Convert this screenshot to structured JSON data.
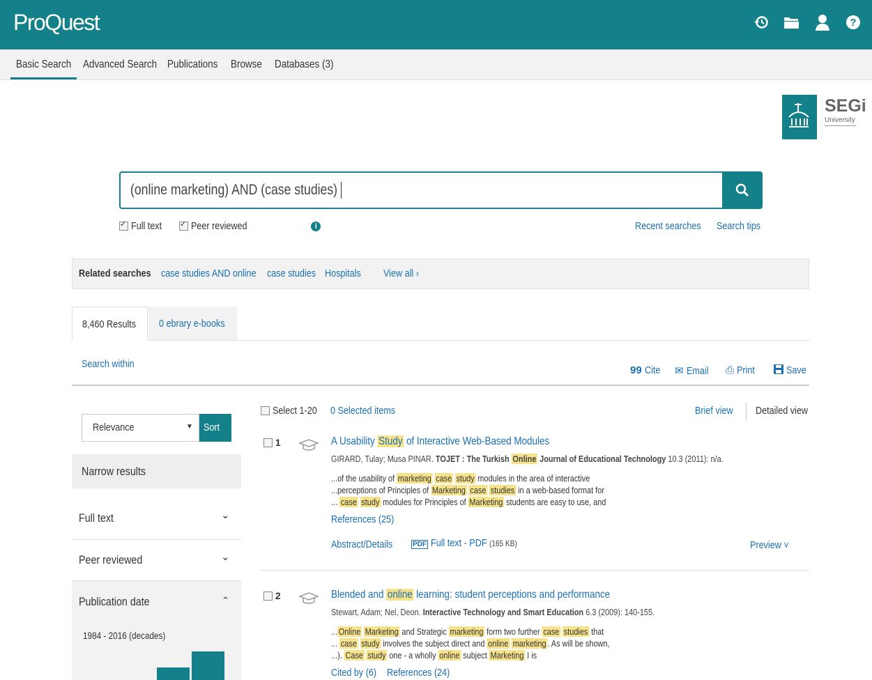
{
  "header": {
    "logo": "ProQuest",
    "icons": [
      "history-icon",
      "folder-icon",
      "user-icon",
      "help-icon"
    ]
  },
  "nav": {
    "tabs": [
      "Basic Search",
      "Advanced Search",
      "Publications",
      "Browse",
      "Databases (3)"
    ],
    "active": "Basic Search"
  },
  "institution": {
    "name": "SEGi",
    "sub": "University"
  },
  "search": {
    "query": "(online marketing) AND (case studies)"
  },
  "options": {
    "full_text": "Full text",
    "peer_reviewed": "Peer reviewed",
    "recent": "Recent searches",
    "tips": "Search tips"
  },
  "related": {
    "label": "Related searches",
    "items": [
      "case studies AND online",
      "case studies",
      "Hospitals"
    ],
    "view_all": "View all ›"
  },
  "results_tabs": {
    "results": "8,460 Results",
    "ebooks": "0 ebrary e-books"
  },
  "toolbar": {
    "search_within": "Search within",
    "cite": "Cite",
    "email": "Email",
    "print": "Print",
    "save": "Save"
  },
  "sort": {
    "selected": "Relevance",
    "button": "Sort"
  },
  "facets": {
    "narrow": "Narrow results",
    "full_text": "Full text",
    "peer_reviewed": "Peer reviewed",
    "pub_date": "Publication date",
    "date_range": "1984 - 2016 (decades)"
  },
  "results_header": {
    "select": "Select 1-20",
    "selected": "0 Selected items",
    "brief": "Brief view",
    "detailed": "Detailed view"
  },
  "results": [
    {
      "num": "1",
      "authors": "GIRARD, Tulay; Musa PINAR.",
      "journal_pre": "TOJET : The Turkish",
      "journal_hl": "Online",
      "journal_post": "Journal of Educational Technology",
      "cite": "10.3  (2011): n/a.",
      "refs": "References (25)",
      "abstract": "Abstract/Details",
      "pdf": "Full text - PDF",
      "pdf_size": "(165 KB)",
      "preview": "Preview ˅"
    },
    {
      "num": "2",
      "title": "Blended and online learning: student perceptions and performance",
      "authors": "Stewart, Adam; Nel, Deon.",
      "journal": "Interactive Technology and Smart Education",
      "cite": "6.3  (2009): 140-155.",
      "cited_by": "Cited by (6)",
      "refs": "References (24)"
    }
  ]
}
